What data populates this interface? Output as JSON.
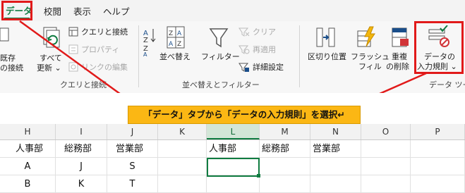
{
  "tabs": [
    {
      "label": "データ"
    },
    {
      "label": "校閲"
    },
    {
      "label": "表示"
    },
    {
      "label": "ヘルプ"
    }
  ],
  "ribbon": {
    "left_cut": {
      "line1": "既存",
      "line2": "の接続"
    },
    "refresh": {
      "line1": "すべて",
      "line2": "更新 ⌄"
    },
    "queries": {
      "label": "クエリと接続"
    },
    "properties": {
      "label": "プロパティ"
    },
    "edit_links": {
      "label": "リンクの編集"
    },
    "group_queries": "クエリと接続",
    "sort_az": {
      "label": "A↓Z"
    },
    "sort": {
      "label": "並べ替え"
    },
    "filter": {
      "label": "フィルター"
    },
    "clear": {
      "label": "クリア"
    },
    "reapply": {
      "label": "再適用"
    },
    "advanced": {
      "label": "詳細設定"
    },
    "group_sort": "並べ替えとフィルター",
    "text_to_columns": {
      "label": "区切り位置"
    },
    "flash_fill": {
      "line1": "フラッシュ",
      "line2": "フィル"
    },
    "remove_dup": {
      "line1": "重複",
      "line2": "の削除"
    },
    "data_validation": {
      "line1": "データの",
      "line2": "入力規則 ⌄"
    },
    "group_tools": "データ ツー"
  },
  "callout": {
    "text": "「データ」タブから「データの入力規則」を選択↵"
  },
  "columns": [
    "H",
    "I",
    "J",
    "K",
    "L",
    "M",
    "N",
    "O",
    "P"
  ],
  "rows": [
    [
      "人事部",
      "総務部",
      "営業部",
      "",
      "人事部",
      "総務部",
      "営業部",
      "",
      ""
    ],
    [
      "A",
      "J",
      "S",
      "",
      "",
      "",
      "",
      "",
      ""
    ],
    [
      "B",
      "K",
      "T",
      "",
      "",
      "",
      "",
      "",
      ""
    ]
  ],
  "colors": {
    "accent": "#107c41",
    "highlight": "#e11a1a",
    "callout": "#fbb714"
  }
}
